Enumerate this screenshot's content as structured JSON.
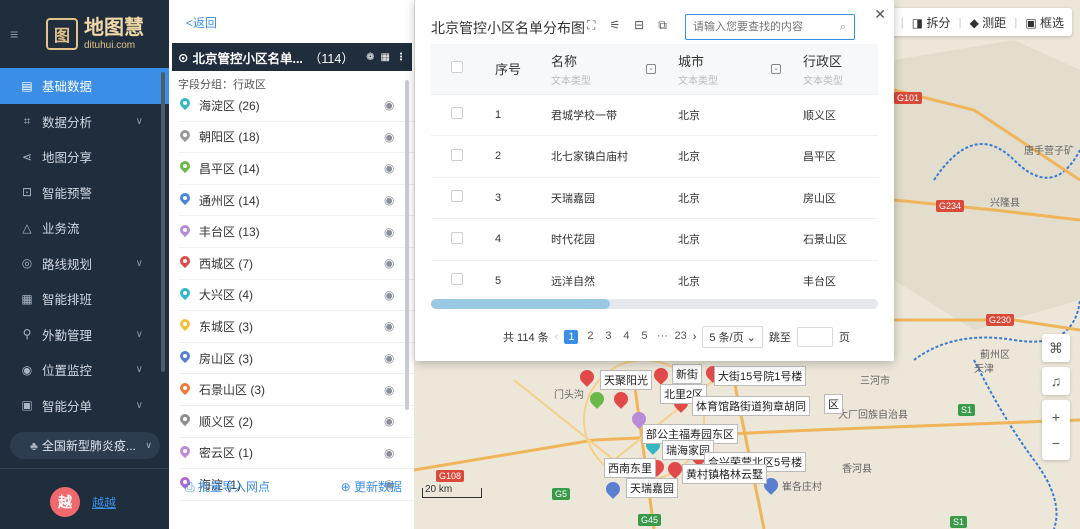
{
  "app": {
    "logo_mark": "图",
    "logo_cn": "地图慧",
    "logo_en": "dituhui.com"
  },
  "nav": {
    "items": [
      {
        "label": "基础数据",
        "icon": "database-icon",
        "glyph": "▤",
        "active": true,
        "has_children": false
      },
      {
        "label": "数据分析",
        "icon": "analysis-icon",
        "glyph": "⌗",
        "active": false,
        "has_children": true
      },
      {
        "label": "地图分享",
        "icon": "share-icon",
        "glyph": "⋖",
        "active": false,
        "has_children": false
      },
      {
        "label": "智能预警",
        "icon": "alert-icon",
        "glyph": "⊡",
        "active": false,
        "has_children": false
      },
      {
        "label": "业务流",
        "icon": "workflow-icon",
        "glyph": "△",
        "active": false,
        "has_children": false
      },
      {
        "label": "路线规划",
        "icon": "route-icon",
        "glyph": "◎",
        "active": false,
        "has_children": true
      },
      {
        "label": "智能排班",
        "icon": "schedule-icon",
        "glyph": "▦",
        "active": false,
        "has_children": false
      },
      {
        "label": "外勤管理",
        "icon": "field-icon",
        "glyph": "⚲",
        "active": false,
        "has_children": true
      },
      {
        "label": "位置监控",
        "icon": "monitor-icon",
        "glyph": "◉",
        "active": false,
        "has_children": true
      },
      {
        "label": "智能分单",
        "icon": "dispatch-icon",
        "glyph": "▣",
        "active": false,
        "has_children": true
      }
    ],
    "org": "全国新型肺炎疫...",
    "user_initial": "越",
    "user_name": "越越"
  },
  "panel": {
    "back": "<返回",
    "layer_title": "北京管控小区名单...",
    "layer_count": "（114）",
    "group_label": "字段分组：行政区",
    "groups": [
      {
        "label": "海淀区 (26)",
        "color": "#35b8c4"
      },
      {
        "label": "朝阳区 (18)",
        "color": "#9a9a9a"
      },
      {
        "label": "昌平区 (14)",
        "color": "#6bb84a"
      },
      {
        "label": "通州区 (14)",
        "color": "#4a86d8"
      },
      {
        "label": "丰台区 (13)",
        "color": "#b98ad6"
      },
      {
        "label": "西城区 (7)",
        "color": "#e24a4a"
      },
      {
        "label": "大兴区 (4)",
        "color": "#2fb8c8"
      },
      {
        "label": "东城区 (3)",
        "color": "#f2c13a"
      },
      {
        "label": "房山区 (3)",
        "color": "#5b7fd0"
      },
      {
        "label": "石景山区 (3)",
        "color": "#f07a3a"
      },
      {
        "label": "顺义区 (2)",
        "color": "#8e8e8e"
      },
      {
        "label": "密云区 (1)",
        "color": "#c08ad6"
      },
      {
        "label": "海淀 (1)",
        "color": "#b06ad0"
      }
    ],
    "import_label": "批量导入网点",
    "refresh_label": "更新数据"
  },
  "map": {
    "toolbar": [
      "井",
      "拆分",
      "测距",
      "框选"
    ],
    "scale": "20 km",
    "labels": [
      "唐手营子矿",
      "兴隆县",
      "蓟州区",
      "天津",
      "三河市",
      "大厂回族自治县",
      "香河县",
      "崔各庄村",
      "G101",
      "G234",
      "G230",
      "S1",
      "S1",
      "G108",
      "G5",
      "G45",
      "S1",
      "门头沟"
    ],
    "pois": [
      "天聚阳光",
      "新街",
      "大街15号院1号楼",
      "北里2区",
      "区",
      "体育馆路街道狗章胡同",
      "部公主福寿园东区",
      "瑞海家园",
      "西南东里",
      "合兴荣营北区5号楼",
      "黄村镇格林云墅",
      "天瑞嘉园"
    ]
  },
  "dialog": {
    "title": "北京管控小区名单分布图",
    "search_placeholder": "请输入您要查找的内容",
    "columns": {
      "no": "序号",
      "name": "名称",
      "name_sub": "文本类型",
      "city": "城市",
      "city_sub": "文本类型",
      "district": "行政区",
      "district_sub": "文本类型"
    },
    "rows": [
      {
        "no": "1",
        "name": "君城学校一带",
        "city": "北京",
        "district": "顺义区"
      },
      {
        "no": "2",
        "name": "北七家镇白庙村",
        "city": "北京",
        "district": "昌平区"
      },
      {
        "no": "3",
        "name": "天瑞嘉园",
        "city": "北京",
        "district": "房山区"
      },
      {
        "no": "4",
        "name": "时代花园",
        "city": "北京",
        "district": "石景山区"
      },
      {
        "no": "5",
        "name": "远洋自然",
        "city": "北京",
        "district": "丰台区"
      }
    ],
    "scroll_position": 0.4,
    "pager": {
      "total": "共 114 条",
      "pages": [
        "1",
        "2",
        "3",
        "4",
        "5",
        "···",
        "23"
      ],
      "current": "1",
      "page_size": "5 条/页",
      "jump_label": "跳至",
      "page_unit": "页"
    }
  }
}
